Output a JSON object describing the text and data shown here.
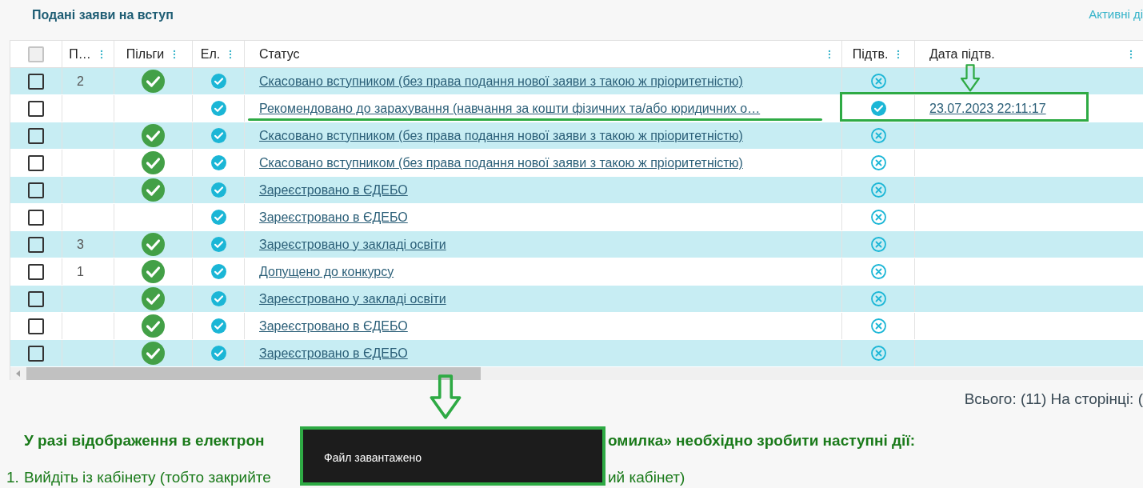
{
  "title": "Подані заяви на вступ",
  "actions_link": "Активні ді",
  "table": {
    "columns": [
      {
        "label": "П…"
      },
      {
        "label": "Пільги"
      },
      {
        "label": "Ел."
      },
      {
        "label": "Статус"
      },
      {
        "label": "Підтв."
      },
      {
        "label": "Дата підтв."
      }
    ],
    "rows": [
      {
        "checked": false,
        "priority": "2",
        "benefit": true,
        "electronic": true,
        "status": "Скасовано вступником (без права подання нової заяви з такою ж пріоритетністю)",
        "confirmed": false
      },
      {
        "checked": false,
        "benefit": false,
        "electronic": true,
        "status": "Рекомендовано до зарахування (навчання за кошти фізичних та/або юридичних о…",
        "confirmed": true,
        "date": "23.07.2023 22:11:17"
      },
      {
        "checked": false,
        "benefit": true,
        "electronic": true,
        "status": "Скасовано вступником (без права подання нової заяви з такою ж пріоритетністю)",
        "confirmed": false
      },
      {
        "checked": false,
        "benefit": true,
        "electronic": true,
        "status": "Скасовано вступником (без права подання нової заяви з такою ж пріоритетністю)",
        "confirmed": false
      },
      {
        "checked": false,
        "benefit": true,
        "electronic": true,
        "status": "Зареєстровано в ЄДЕБО",
        "confirmed": false
      },
      {
        "checked": false,
        "benefit": false,
        "electronic": true,
        "status": "Зареєстровано в ЄДЕБО",
        "confirmed": false
      },
      {
        "checked": false,
        "priority": "3",
        "benefit": true,
        "electronic": true,
        "status": "Зареєстровано у закладі освіти",
        "confirmed": false
      },
      {
        "checked": false,
        "priority": "1",
        "benefit": true,
        "electronic": true,
        "status": "Допущено до конкурсу",
        "confirmed": false
      },
      {
        "checked": false,
        "benefit": true,
        "electronic": true,
        "status": "Зареєстровано у закладі освіти",
        "confirmed": false
      },
      {
        "checked": false,
        "benefit": true,
        "electronic": true,
        "status": "Зареєстровано в ЄДЕБО",
        "confirmed": false
      },
      {
        "checked": false,
        "benefit": true,
        "electronic": true,
        "status": "Зареєстровано в ЄДЕБО",
        "confirmed": false
      }
    ],
    "select_all_checked": false
  },
  "pagination": "Всього: (11) На сторінці: (",
  "notice_heading": {
    "text_start": "У разі відображення в електрон",
    "text_end": "омилка» необхідно зробити наступні дії:"
  },
  "instruction": {
    "number": "1.",
    "text_start": "Вийдіть із кабінету (тобто закрийте",
    "text_end": "ий кабінет)"
  },
  "toast": {
    "message": "Файл завантажено"
  }
}
